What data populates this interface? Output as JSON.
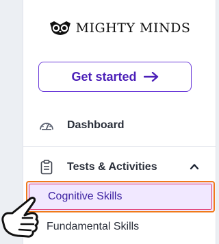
{
  "brand": {
    "name": "MIGHTY MINDS",
    "logo_icon": "owl-logo-icon"
  },
  "cta": {
    "label": "Get started",
    "icon": "arrow-right-icon"
  },
  "nav": {
    "dashboard": {
      "label": "Dashboard",
      "icon": "gauge-icon"
    },
    "tests": {
      "label": "Tests & Activities",
      "icon": "clipboard-icon",
      "expanded": true
    },
    "sub_items": [
      {
        "label": "Cognitive Skills",
        "highlighted": true
      },
      {
        "label": "Fundamental Skills"
      }
    ]
  },
  "colors": {
    "accent": "#6c3cd9",
    "highlight_bg": "#f1e8ff",
    "highlight_border": "#f07a1a"
  }
}
